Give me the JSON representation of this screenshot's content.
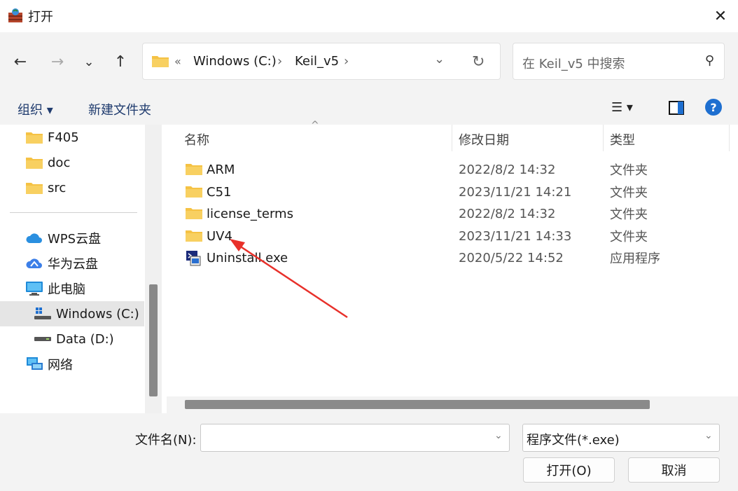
{
  "window": {
    "title": "打开",
    "close_glyph": "✕"
  },
  "nav": {
    "back": "←",
    "forward": "→",
    "recent": "⌄",
    "up": "↑"
  },
  "address": {
    "overflow": "«",
    "crumbs": [
      "Windows (C:)",
      "Keil_v5"
    ],
    "sep": "›",
    "dropdown": "⌄",
    "refresh": "↻"
  },
  "search": {
    "placeholder": "在 Keil_v5 中搜索",
    "icon": "⚲"
  },
  "toolbar": {
    "organize": "组织 ▾",
    "new_folder": "新建文件夹",
    "view_glyph": "☰ ▾",
    "help": "?"
  },
  "sidebar": {
    "items": [
      {
        "label": "F405",
        "icon": "folder-icon"
      },
      {
        "label": "doc",
        "icon": "folder-icon"
      },
      {
        "label": "src",
        "icon": "folder-icon"
      },
      {
        "label": "WPS云盘",
        "icon": "cloud-icon"
      },
      {
        "label": "华为云盘",
        "icon": "cloud-icon"
      },
      {
        "label": "此电脑",
        "icon": "computer-icon"
      },
      {
        "label": "Windows (C:)",
        "icon": "drive-icon",
        "selected": true
      },
      {
        "label": "Data (D:)",
        "icon": "drive-icon"
      },
      {
        "label": "网络",
        "icon": "network-icon"
      }
    ]
  },
  "columns": {
    "name": "名称",
    "modified": "修改日期",
    "type": "类型",
    "sort_glyph": "^"
  },
  "files": [
    {
      "name": "ARM",
      "date": "2022/8/2 14:32",
      "type": "文件夹",
      "icon": "folder-icon"
    },
    {
      "name": "C51",
      "date": "2023/11/21 14:21",
      "type": "文件夹",
      "icon": "folder-icon"
    },
    {
      "name": "license_terms",
      "date": "2022/8/2 14:32",
      "type": "文件夹",
      "icon": "folder-icon"
    },
    {
      "name": "UV4",
      "date": "2023/11/21 14:33",
      "type": "文件夹",
      "icon": "folder-icon"
    },
    {
      "name": "Uninstall.exe",
      "date": "2020/5/22 14:52",
      "type": "应用程序",
      "icon": "exe-icon"
    }
  ],
  "footer": {
    "filename_label": "文件名(N):",
    "filename_value": "",
    "filter_value": "程序文件(*.exe)",
    "open_button": "打开(O)",
    "cancel_button": "取消"
  },
  "colors": {
    "accent": "#0067c0",
    "folder": "#f5c244",
    "arrow": "#e8302a"
  }
}
